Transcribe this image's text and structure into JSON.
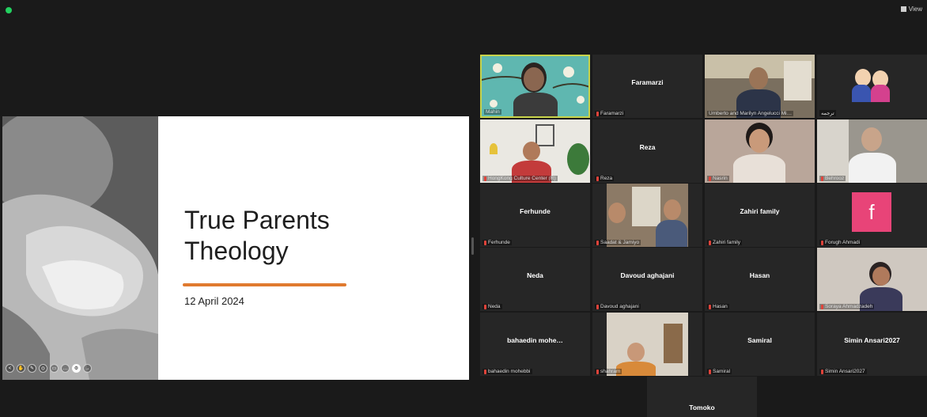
{
  "window": {
    "view_label": "View"
  },
  "slide": {
    "title": "True Parents\nTheology",
    "date": "12 April 2024",
    "controls": [
      "<",
      "✋",
      "✎",
      "◎",
      "▭",
      "…",
      "⚙",
      "→"
    ]
  },
  "participants": [
    {
      "name": "Mahin",
      "center": "",
      "video": true,
      "active": true
    },
    {
      "name": "Faramarzi",
      "center": "Faramarzi",
      "video": false
    },
    {
      "name": "Umberto and Marilyn Angelucci Mi…",
      "center": "",
      "video": true
    },
    {
      "name": "ترجمه",
      "center": "",
      "video": true
    },
    {
      "name": "HongKong Culture Center (R)",
      "center": "",
      "video": true
    },
    {
      "name": "Reza",
      "center": "Reza",
      "video": false
    },
    {
      "name": "Nasrin",
      "center": "",
      "video": true
    },
    {
      "name": "Behrooz",
      "center": "",
      "video": true
    },
    {
      "name": "Ferhunde",
      "center": "Ferhunde",
      "video": false
    },
    {
      "name": "Saadat & Jamiyo",
      "center": "",
      "video": true
    },
    {
      "name": "Zahiri family",
      "center": "Zahiri family",
      "video": false
    },
    {
      "name": "Forugh Ahmadi",
      "center": "",
      "video": false,
      "avatar": "f"
    },
    {
      "name": "Neda",
      "center": "Neda",
      "video": false
    },
    {
      "name": "Davoud aghajani",
      "center": "Davoud aghajani",
      "video": false
    },
    {
      "name": "Hasan",
      "center": "Hasan",
      "video": false
    },
    {
      "name": "Soraya Ahmadzadeh",
      "center": "",
      "video": true
    },
    {
      "name": "bahaedin mohebbi",
      "center": "bahaedin mohe…",
      "video": false
    },
    {
      "name": "shahram",
      "center": "",
      "video": true
    },
    {
      "name": "Samiral",
      "center": "Samiral",
      "video": false
    },
    {
      "name": "Simin Ansari2027",
      "center": "Simin Ansari2027",
      "video": false
    },
    {
      "name": "",
      "center": "Tomoko",
      "video": false
    }
  ]
}
